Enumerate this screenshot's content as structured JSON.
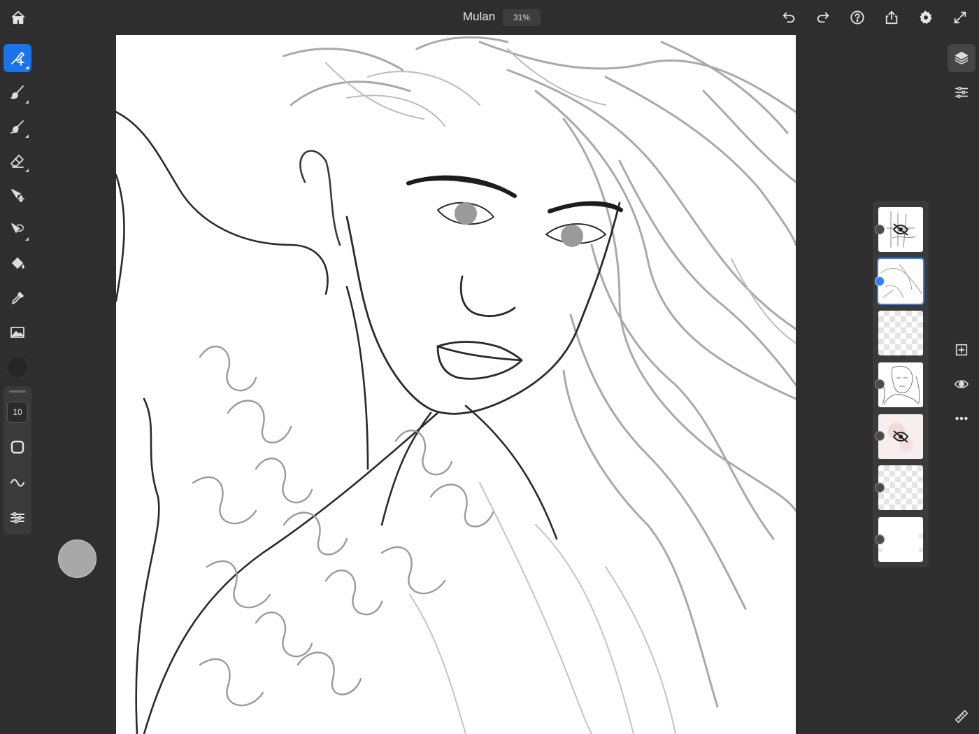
{
  "app": {
    "document_title": "Mulan",
    "zoom_level": "31%"
  },
  "top_toolbar": {
    "left": [
      "home-icon"
    ],
    "right": [
      "undo-icon",
      "redo-icon",
      "help-icon",
      "share-icon",
      "settings-icon",
      "fullscreen-icon"
    ]
  },
  "left_toolbar": {
    "tools": [
      {
        "icon": "layer-brush-icon",
        "active": true
      },
      {
        "icon": "brush-icon",
        "active": false
      },
      {
        "icon": "smudge-icon",
        "active": false
      },
      {
        "icon": "eraser-icon",
        "active": false
      },
      {
        "icon": "transform-icon",
        "active": false
      },
      {
        "icon": "lasso-icon",
        "active": false
      },
      {
        "icon": "fill-icon",
        "active": false
      },
      {
        "icon": "eyedropper-icon",
        "active": false
      },
      {
        "icon": "image-icon",
        "active": false
      }
    ],
    "current_color": "#262626",
    "brush_size": "10",
    "brush_panel": [
      "brush-shape-icon",
      "stroke-smoothing-icon",
      "brush-settings-icon"
    ]
  },
  "layers": [
    {
      "name": "layer-1",
      "hidden": true,
      "selected": false,
      "thumb": "sketch"
    },
    {
      "name": "layer-2",
      "hidden": false,
      "selected": true,
      "thumb": "sketch-light"
    },
    {
      "name": "layer-3",
      "hidden": false,
      "selected": false,
      "thumb": "empty"
    },
    {
      "name": "layer-4",
      "hidden": false,
      "selected": false,
      "thumb": "portrait"
    },
    {
      "name": "layer-5",
      "hidden": true,
      "selected": false,
      "thumb": "pink"
    },
    {
      "name": "layer-6",
      "hidden": false,
      "selected": false,
      "thumb": "empty"
    },
    {
      "name": "layer-7",
      "hidden": false,
      "selected": false,
      "thumb": "white"
    }
  ],
  "right_toolbar": [
    "layers-icon",
    "adjustments-icon",
    "add-layer-icon",
    "visibility-icon",
    "more-icon",
    "ruler-icon"
  ],
  "colors": {
    "accent": "#1a73e8",
    "ui_background": "#2e2e2e"
  }
}
